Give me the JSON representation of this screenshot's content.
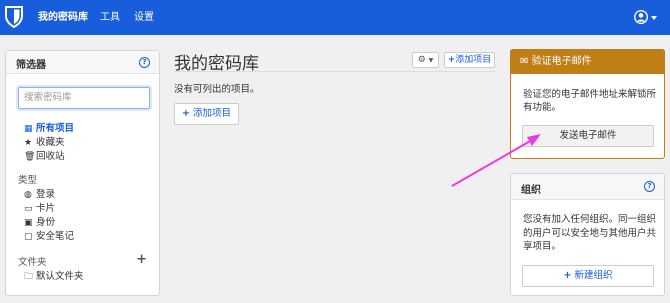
{
  "topbar": {
    "logo_icon": "shield-icon",
    "nav": [
      "我的密码库",
      "工具",
      "设置"
    ],
    "account_icon": "user-circle-icon"
  },
  "filters": {
    "title": "筛选器",
    "search_placeholder": "搜索密码库",
    "items": [
      {
        "icon": "grid-icon",
        "label": "所有项目",
        "active": true
      },
      {
        "icon": "star-icon",
        "label": "收藏夹"
      },
      {
        "icon": "trash-icon",
        "label": "回收站"
      }
    ],
    "types_label": "类型",
    "types": [
      {
        "icon": "globe-icon",
        "label": "登录"
      },
      {
        "icon": "credit-card-icon",
        "label": "卡片"
      },
      {
        "icon": "id-card-icon",
        "label": "身份"
      },
      {
        "icon": "note-icon",
        "label": "安全笔记"
      }
    ],
    "folders_label": "文件夹",
    "folders": [
      {
        "icon": "folder-icon",
        "label": "默认文件夹"
      }
    ]
  },
  "main": {
    "title": "我的密码库",
    "add_item_small": "添加项目",
    "empty_text": "没有可列出的项目。",
    "add_item": "添加项目"
  },
  "verify": {
    "title": "验证电子邮件",
    "text": "验证您的电子邮件地址来解锁所有功能。",
    "button": "发送电子邮件",
    "color": "#bf7e16"
  },
  "org": {
    "title": "组织",
    "text": "您没有加入任何组织。同一组织的用户可以安全地与其他用户共享项目。",
    "button": "新建组织"
  },
  "colors": {
    "brand": "#175ddc",
    "annotation_arrow": "#e83be8"
  }
}
